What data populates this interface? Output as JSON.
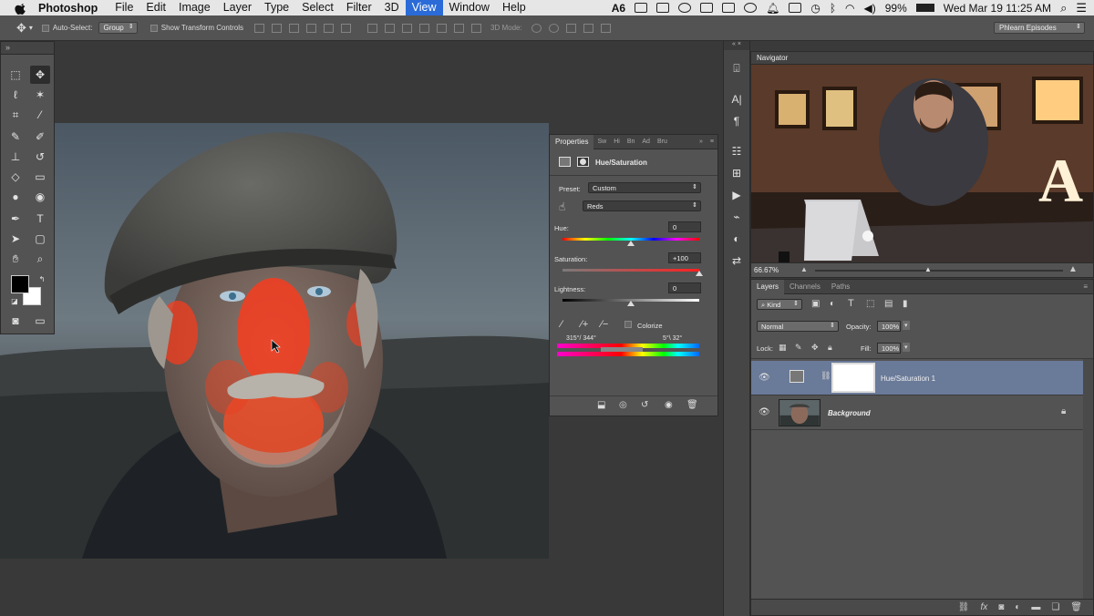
{
  "menubar": {
    "app": "Photoshop",
    "items": [
      "File",
      "Edit",
      "Image",
      "Layer",
      "Type",
      "Select",
      "Filter",
      "3D",
      "View",
      "Window",
      "Help"
    ],
    "active": "View",
    "status_count": "6",
    "battery": "99%",
    "datetime": "Wed Mar 19  11:25 AM"
  },
  "options": {
    "auto_select_label": "Auto-Select:",
    "auto_select_value": "Group",
    "show_transform_label": "Show Transform Controls",
    "mode_3d_label": "3D Mode:",
    "workspace": "Phlearn Episodes"
  },
  "properties": {
    "tabs": [
      "Properties",
      "Sw",
      "Hi",
      "Bn",
      "Ad",
      "Bru"
    ],
    "adjustment": "Hue/Saturation",
    "preset_label": "Preset:",
    "preset_value": "Custom",
    "channel_value": "Reds",
    "hue_label": "Hue:",
    "hue_value": "0",
    "hue_level": 0.5,
    "saturation_label": "Saturation:",
    "saturation_value": "+100",
    "saturation_level": 1.0,
    "lightness_label": "Lightness:",
    "lightness_value": "0",
    "lightness_level": 0.5,
    "colorize_label": "Colorize",
    "range_left": "315°/ 344°",
    "range_right": "5°\\ 32°"
  },
  "navigator": {
    "title": "Navigator",
    "zoom": "66.67%"
  },
  "layers": {
    "tabs": [
      "Layers",
      "Channels",
      "Paths"
    ],
    "kind_label": "Kind",
    "blend_mode": "Normal",
    "opacity_label": "Opacity:",
    "opacity_value": "100%",
    "lock_label": "Lock:",
    "fill_label": "Fill:",
    "fill_value": "100%",
    "items": [
      {
        "name": "Hue/Saturation 1"
      },
      {
        "name": "Background"
      }
    ]
  },
  "colors": {
    "accent": "#2a6bd8",
    "panel": "#535353",
    "selected_layer": "#6a7a99"
  }
}
